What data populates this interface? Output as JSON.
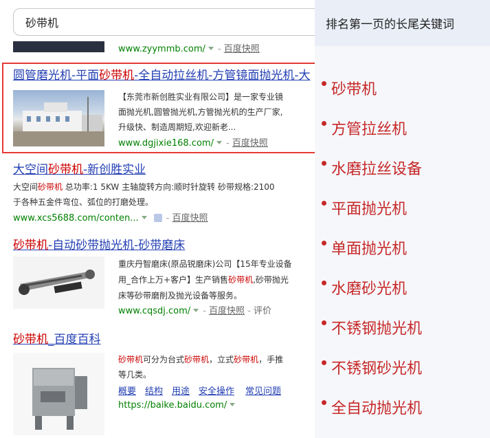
{
  "search": {
    "value": "砂带机"
  },
  "prev": {
    "url": "www.zyymmb.com/",
    "kuaizhao": "百度快照"
  },
  "results": [
    {
      "title_pre": "圆管磨光机-平面",
      "title_hl": "砂带机",
      "title_post": "-全自动拉丝机-方管镜面抛光机-大",
      "desc1": "【东莞市新创胜实业有限公司】是一家专业镜",
      "desc2": "面抛光机,圆管抛光机,方管抛光机的生产厂家,",
      "desc3": "升级快、制造周期短,欢迎新老...",
      "url": "www.dgjixie168.com/",
      "kuaizhao": "百度快照"
    },
    {
      "title_pre": "大空间",
      "title_hl": "砂带机",
      "title_post": "-新创胜实业",
      "desc1_pre": "大空间",
      "desc1_hl": "砂带机",
      "desc1_post": " 总功率:1 5KW 主轴旋转方向:顺时针旋转 砂带规格:2100",
      "desc2": "于各种五金件弯位、弧位的打磨处理。",
      "url": "www.xcs5688.com/conten...",
      "kuaizhao": "百度快照"
    },
    {
      "title_pre": "",
      "title_hl": "砂带机",
      "title_post": "-自动砂带抛光机-砂带磨床",
      "desc1": "重庆丹智磨床(原品锐磨床)公司【15年专业设备",
      "desc2_pre": "用_合作上万+客户】生产销售",
      "desc2_hl": "砂带机",
      "desc2_post": ",砂带抛光",
      "desc3": "床等砂带磨削及抛光设备等服务。",
      "url": "www.cqsdj.com/",
      "kuaizhao": "百度快照",
      "extra": "评价"
    },
    {
      "title_pre": "",
      "title_hl": "砂带机",
      "title_post": "_百度百科",
      "desc1_hl1": "砂带机",
      "desc1_mid1": "可分为台式",
      "desc1_hl2": "砂带机",
      "desc1_mid2": "，立式",
      "desc1_hl3": "砂带机",
      "desc1_post": "，手推",
      "desc2": "等几类。",
      "links": [
        "概要",
        "结构",
        "用途",
        "安全操作",
        "常见问题"
      ],
      "url": "https://baike.baidu.com/"
    }
  ],
  "sidebar": {
    "title": "排名第一页的长尾关键词",
    "keywords": [
      "砂带机",
      "方管拉丝机",
      "水磨拉丝设备",
      "平面抛光机",
      "单面抛光机",
      "水磨砂光机",
      "不锈钢抛光机",
      "不锈钢砂光机",
      "全自动抛光机"
    ]
  },
  "colors": {
    "link": "#2440b3",
    "highlight": "#cc0000",
    "url": "#008000",
    "box": "#e53935",
    "keyword": "#c62828"
  }
}
